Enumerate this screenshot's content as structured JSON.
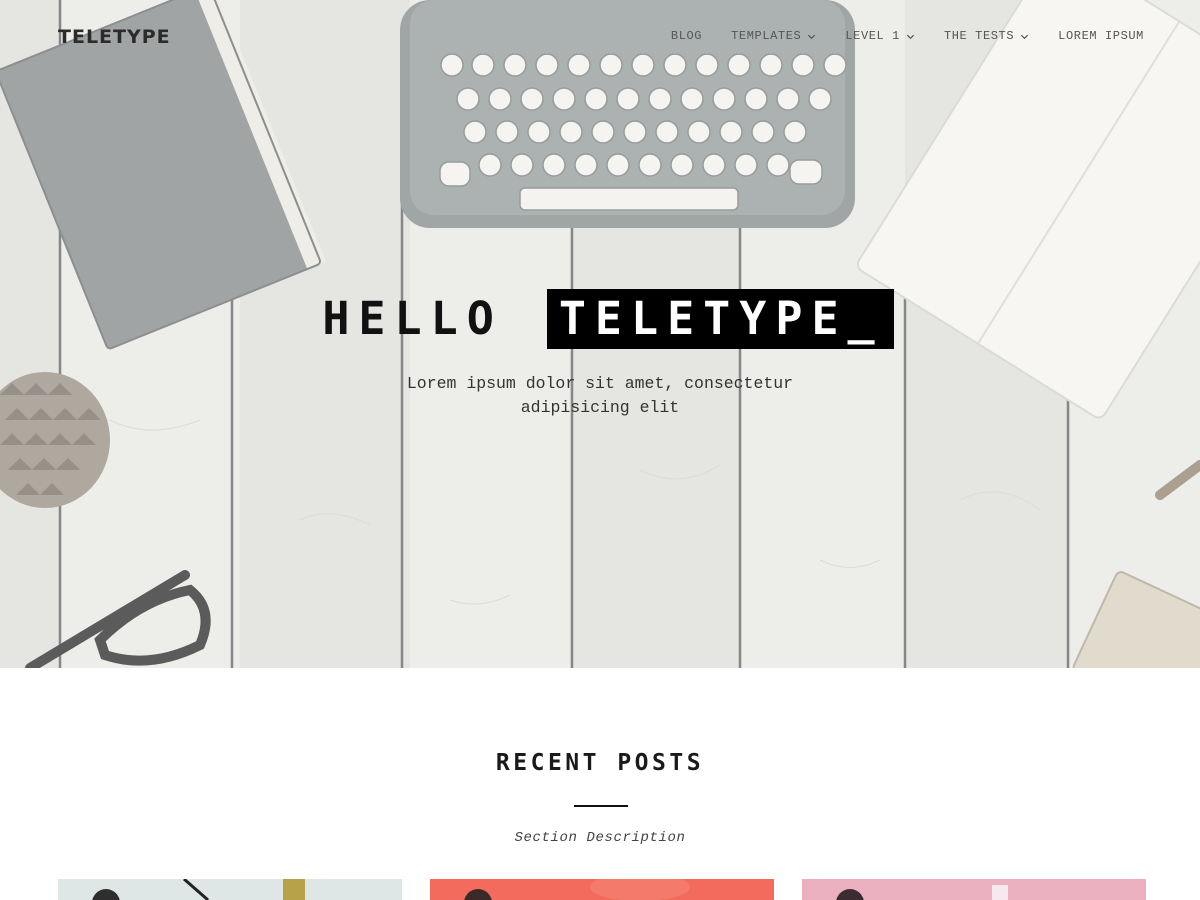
{
  "site": {
    "title": "TELETYPE"
  },
  "nav": {
    "items": [
      {
        "label": "BLOG",
        "has_dropdown": false
      },
      {
        "label": "TEMPLATES",
        "has_dropdown": true
      },
      {
        "label": "LEVEL 1",
        "has_dropdown": true
      },
      {
        "label": "THE TESTS",
        "has_dropdown": true
      },
      {
        "label": "LOREM IPSUM",
        "has_dropdown": false
      }
    ]
  },
  "hero": {
    "title_plain": "HELLO",
    "title_highlight": "TELETYPE_",
    "subtitle": "Lorem ipsum dolor sit amet, consectetur adipisicing elit"
  },
  "recent_posts": {
    "title": "RECENT POSTS",
    "description": "Section Description"
  },
  "colors": {
    "highlight_bg": "#000000",
    "highlight_text": "#ffffff",
    "card_1": "#dfe6e6",
    "card_2": "#f26b5c",
    "card_3": "#eab0bf"
  },
  "icons": {
    "dropdown": "chevron-down-icon"
  }
}
